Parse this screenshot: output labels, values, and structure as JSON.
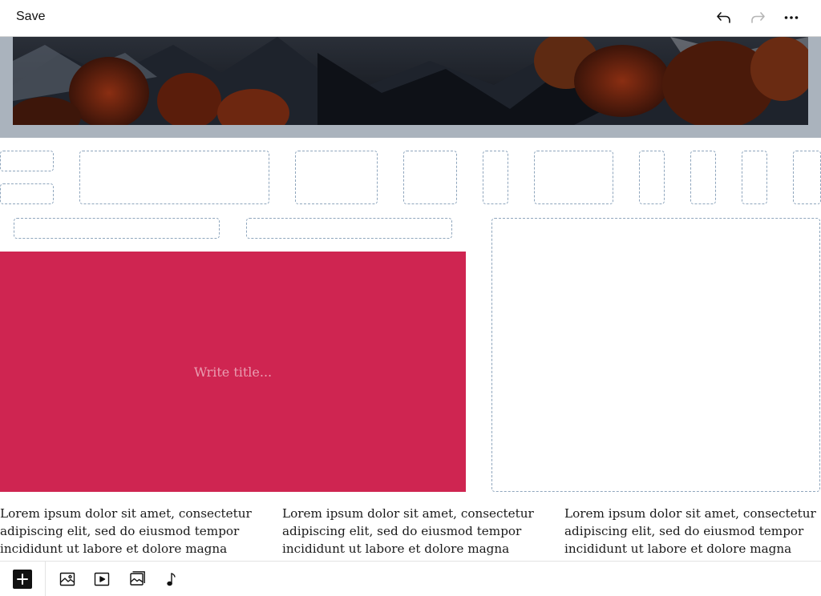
{
  "toolbar": {
    "save_label": "Save",
    "icons": [
      "undo-icon",
      "redo-icon",
      "more-icon"
    ]
  },
  "hero": {
    "image": "mountain-autumn-image"
  },
  "title_card": {
    "placeholder": "Write title...",
    "color": "#cf2551"
  },
  "columns": [
    {
      "text": "Lorem ipsum dolor sit amet, consectetur adipiscing elit, sed do eiusmod tempor incididunt ut labore et dolore magna"
    },
    {
      "text": "Lorem ipsum dolor sit amet, consectetur adipiscing elit, sed do eiusmod tempor incididunt ut labore et dolore magna"
    },
    {
      "text": "Lorem ipsum dolor sit amet, consectetur adipiscing elit, sed do eiusmod tempor incididunt ut labore et dolore magna"
    }
  ],
  "bottom_toolbar": {
    "icons": [
      "add-icon",
      "image-icon",
      "video-icon",
      "gallery-icon",
      "audio-icon"
    ]
  },
  "colors": {
    "accent": "#cf2551",
    "placeholder_border": "#8fa6bd",
    "hero_frame": "#aab3bd"
  }
}
